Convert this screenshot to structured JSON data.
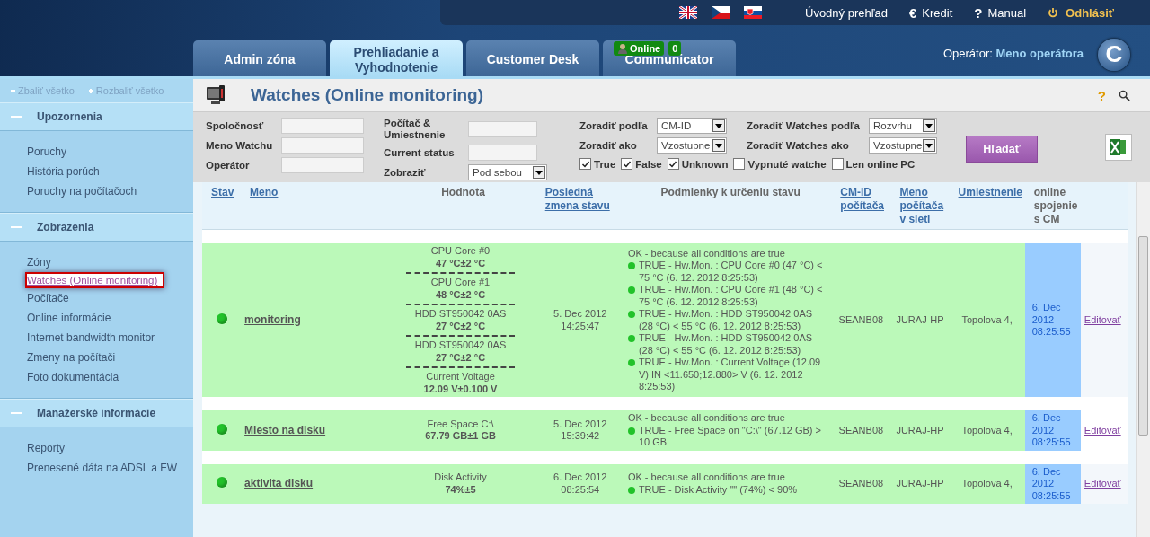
{
  "header": {
    "flags": [
      {
        "kind": "uk"
      },
      {
        "kind": "cz"
      },
      {
        "kind": "sk"
      }
    ],
    "links": [
      {
        "kind": "plain",
        "label": "Úvodný prehľad"
      },
      {
        "kind": "credit",
        "icon": "€",
        "label": "Kredit"
      },
      {
        "kind": "help",
        "icon": "?",
        "label": "Manual"
      },
      {
        "kind": "logout",
        "label": "Odhlásiť"
      }
    ],
    "tabs": [
      {
        "label": "Admin zóna",
        "selected": false
      },
      {
        "label": "Prehliadanie a Vyhodnotenie",
        "selected": true
      },
      {
        "label": "Customer Desk",
        "selected": false
      },
      {
        "label": "Communicator",
        "selected": false,
        "badge": {
          "status": "Online",
          "count": "0"
        }
      }
    ],
    "operator": {
      "label": "Operátor:",
      "name": "Meno operátora"
    },
    "logo": "C"
  },
  "sidebar": {
    "collapse_all": "Zbaliť všetko",
    "expand_all": "Rozbaliť všetko",
    "sections": [
      {
        "title": "Upozornenia",
        "expanded": true,
        "items": [
          {
            "label": "Poruchy",
            "selected": false
          },
          {
            "label": "História porúch",
            "selected": false
          },
          {
            "label": "Poruchy na počítačoch",
            "selected": false
          }
        ]
      },
      {
        "title": "Zobrazenia",
        "expanded": true,
        "items": [
          {
            "label": "Zóny",
            "selected": false
          },
          {
            "label": "Watches (Online monitoring)",
            "selected": true
          },
          {
            "label": "Počítače",
            "selected": false
          },
          {
            "label": "Online informácie",
            "selected": false
          },
          {
            "label": "Internet bandwidth monitor",
            "selected": false
          },
          {
            "label": "Zmeny na počítači",
            "selected": false
          },
          {
            "label": "Foto dokumentácia",
            "selected": false
          }
        ]
      },
      {
        "title": "Manažerské informácie",
        "expanded": true,
        "items": [
          {
            "label": "Reporty",
            "selected": false
          },
          {
            "label": "Prenesené dáta na ADSL a FW",
            "selected": false
          }
        ]
      }
    ]
  },
  "page": {
    "title": "Watches (Online monitoring)",
    "help": "?"
  },
  "filters": {
    "col1": [
      {
        "label": "Spoločnosť",
        "kind": "text"
      },
      {
        "label": "Meno Watchu",
        "kind": "text"
      },
      {
        "label": "Operátor",
        "kind": "text"
      }
    ],
    "col2": [
      {
        "label": "Počítač & Umiestnenie",
        "kind": "text"
      },
      {
        "label": "Current status",
        "kind": "text"
      },
      {
        "label": "Zobraziť",
        "kind": "select",
        "value": "Pod sebou"
      }
    ],
    "col3": [
      {
        "label": "Zoradiť podľa",
        "kind": "select",
        "value": "CM-ID"
      },
      {
        "label": "Zoradiť ako",
        "kind": "select",
        "value": "Vzostupne"
      }
    ],
    "col4": [
      {
        "label": "Zoradiť Watches podľa",
        "kind": "select",
        "value": "Rozvrhu"
      },
      {
        "label": "Zoradiť Watches ako",
        "kind": "select",
        "value": "Vzostupne"
      }
    ],
    "checkboxes": [
      {
        "label": "True",
        "checked": true
      },
      {
        "label": "False",
        "checked": true
      },
      {
        "label": "Unknown",
        "checked": true
      },
      {
        "label": "Vypnuté watche",
        "checked": false
      },
      {
        "label": "Len online PC",
        "checked": false
      }
    ],
    "search_button": "Hľadať"
  },
  "table": {
    "columns": [
      {
        "label": "Stav",
        "sortable": true
      },
      {
        "label": "Meno",
        "sortable": true
      },
      {
        "label": "Hodnota",
        "sortable": false
      },
      {
        "label": "Posledná zmena stavu",
        "sortable": true
      },
      {
        "label": "Podmienky k určeniu stavu",
        "sortable": false
      },
      {
        "label": "CM-ID počítača",
        "sortable": true
      },
      {
        "label": "Meno počítača v sieti",
        "sortable": true
      },
      {
        "label": "Umiestnenie",
        "sortable": true
      },
      {
        "label": "online spojenie s CM",
        "sortable": false
      }
    ],
    "rows": [
      {
        "name": "monitoring",
        "values": [
          {
            "label": "CPU Core #0",
            "value": "47 °C±2 °C"
          },
          {
            "label": "CPU Core #1",
            "value": "48 °C±2 °C"
          },
          {
            "label": "HDD ST950042 0AS",
            "value": "27 °C±2 °C"
          },
          {
            "label": "HDD ST950042 0AS",
            "value": "27 °C±2 °C"
          },
          {
            "label": "Current Voltage",
            "value": "12.09 V±0.100 V"
          }
        ],
        "last_change": [
          "5. Dec 2012",
          "14:25:47"
        ],
        "summary": "OK - because all conditions are true",
        "conditions": [
          "TRUE - Hw.Mon. : CPU Core #0 (47 °C) < 75 °C (6. 12. 2012 8:25:53)",
          "TRUE - Hw.Mon. : CPU Core #1 (48 °C) < 75 °C (6. 12. 2012 8:25:53)",
          "TRUE - Hw.Mon. : HDD ST950042 0AS (28 °C) < 55 °C (6. 12. 2012 8:25:53)",
          "TRUE - Hw.Mon. : HDD ST950042 0AS (28 °C) < 55 °C (6. 12. 2012 8:25:53)",
          "TRUE - Hw.Mon. : Current Voltage (12.09 V) IN <11.650;12.880> V (6. 12. 2012 8:25:53)"
        ],
        "cm_id": "SEANB08",
        "pc_name": "JURAJ-HP",
        "location": "Topolova 4,",
        "online_since": [
          "6. Dec",
          "2012",
          "08:25:55"
        ],
        "edit": "Editovať"
      },
      {
        "name": "Miesto na disku",
        "values": [
          {
            "label": "Free Space C:\\",
            "value": "67.79 GB±1 GB"
          }
        ],
        "last_change": [
          "5. Dec 2012",
          "15:39:42"
        ],
        "summary": "OK - because all conditions are true",
        "conditions": [
          "TRUE - Free Space on \"C:\\\" (67.12 GB) > 10 GB"
        ],
        "cm_id": "SEANB08",
        "pc_name": "JURAJ-HP",
        "location": "Topolova 4,",
        "online_since": [
          "6. Dec",
          "2012",
          "08:25:55"
        ],
        "edit": "Editovať"
      },
      {
        "name": "aktivita disku",
        "values": [
          {
            "label": "Disk Activity",
            "value": "74%±5"
          }
        ],
        "last_change": [
          "6. Dec 2012",
          "08:25:54"
        ],
        "summary": "OK - because all conditions are true",
        "conditions": [
          "TRUE - Disk Activity \"\" (74%) < 90%"
        ],
        "cm_id": "SEANB08",
        "pc_name": "JURAJ-HP",
        "location": "Topolova 4,",
        "online_since": [
          "6. Dec",
          "2012",
          "08:25:55"
        ],
        "edit": "Editovať"
      }
    ]
  }
}
